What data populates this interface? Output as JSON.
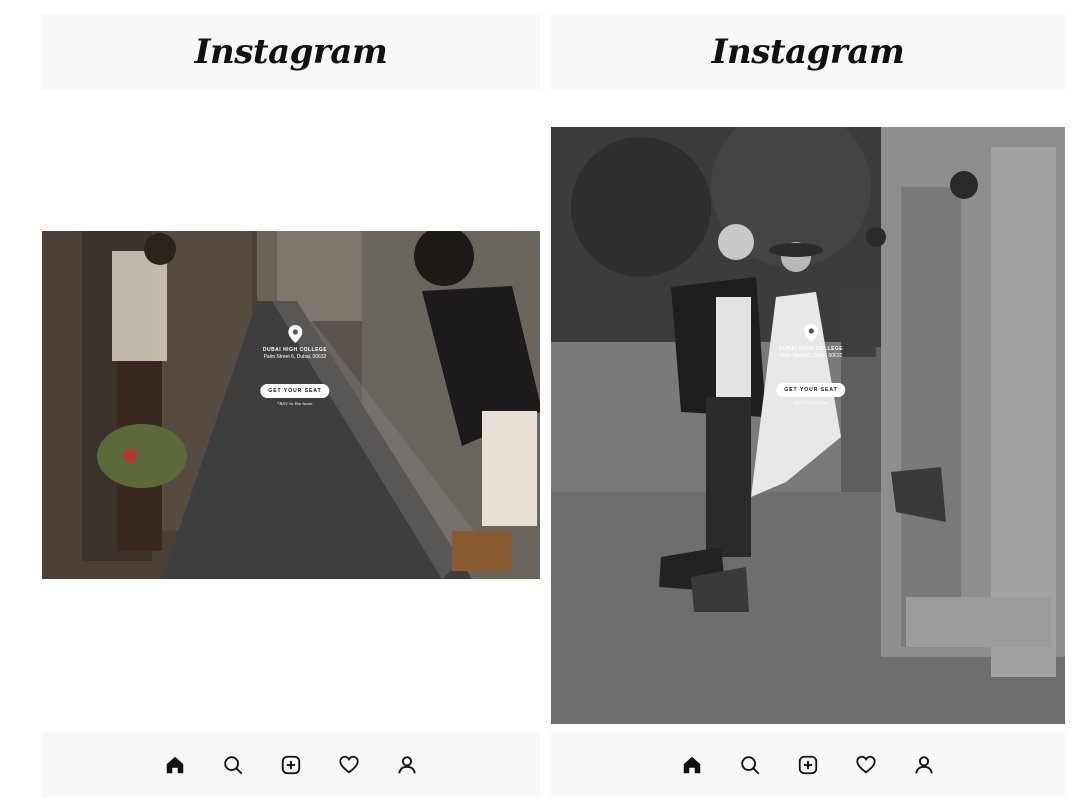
{
  "app": {
    "logo_text": "Instagram"
  },
  "post": {
    "venue_name": "DUBAI HIGH COLLEGE",
    "venue_address": "Palm Street 6, Dubai, 00632",
    "cta_label": "GET YOUR SEAT",
    "cta_note": "*RSV to the team"
  },
  "nav": [
    "home-icon",
    "search-icon",
    "add-post-icon",
    "heart-icon",
    "profile-icon"
  ],
  "colors": {
    "bar_bg": "#f8f8f8",
    "icon": "#111111"
  }
}
